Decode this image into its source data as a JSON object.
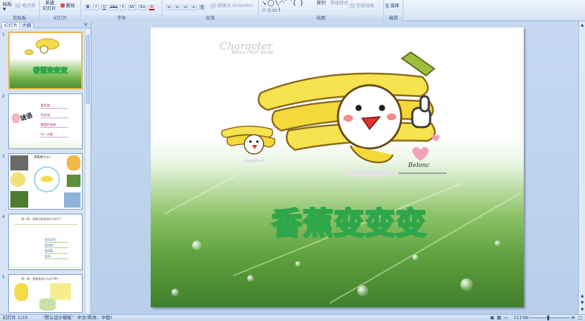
{
  "ribbon": {
    "clipboard": {
      "paste": "粘贴",
      "format_painter": "格式刷",
      "label": "剪贴板"
    },
    "slides": {
      "new_slide_line1": "新建",
      "new_slide_line2": "幻灯片",
      "delete": "删除",
      "label": "幻灯片"
    },
    "font": {
      "label": "字体",
      "bold": "B",
      "italic": "I",
      "underline": "U",
      "strike": "abc",
      "shadow": "S",
      "spacing": "AV",
      "case": "Aa",
      "color": "A"
    },
    "paragraph": {
      "label": "段落",
      "smartart": "转换为 SmartArt"
    },
    "drawing": {
      "arrange": "排列",
      "quick_styles": "快速样式",
      "shape_effects": "形状效果",
      "label": "绘图"
    },
    "editing": {
      "select": "选择",
      "label": "编辑"
    }
  },
  "leftpanel": {
    "tab_slides": "幻灯片",
    "tab_outline": "大纲",
    "close": "×",
    "thumbnails": [
      {
        "num": "1",
        "title": "香蕉变变变"
      },
      {
        "num": "2",
        "title": "谜语",
        "lines": [
          "黄衣裳",
          "弯弯身",
          "甜甜的滋味",
          "打一水果"
        ]
      },
      {
        "num": "3",
        "title": "香蕉像什么？"
      },
      {
        "num": "4",
        "title": "第一版，香蕉还能变成什么样子？",
        "lines": [
          "变成月亮",
          "变成船",
          "变成鼓",
          "变成…"
        ]
      },
      {
        "num": "5",
        "title": "第一版，香蕉变成什么样子呢？"
      }
    ]
  },
  "slide": {
    "watermark_title": "Character",
    "watermark_sub": "Belons FRUIT Vol.02",
    "signature": "Belonc",
    "title": "香蕉变变变"
  },
  "statusbar": {
    "slide_info": "幻灯片 1/10",
    "theme": "\"默认设计模板\"",
    "language": "中文(简体，中国)",
    "zoom": "111%"
  },
  "colors": {
    "title_outline": "#2fa64a",
    "ribbon_bg": "#dde9f7",
    "workspace_bg": "#bfd5ee"
  }
}
